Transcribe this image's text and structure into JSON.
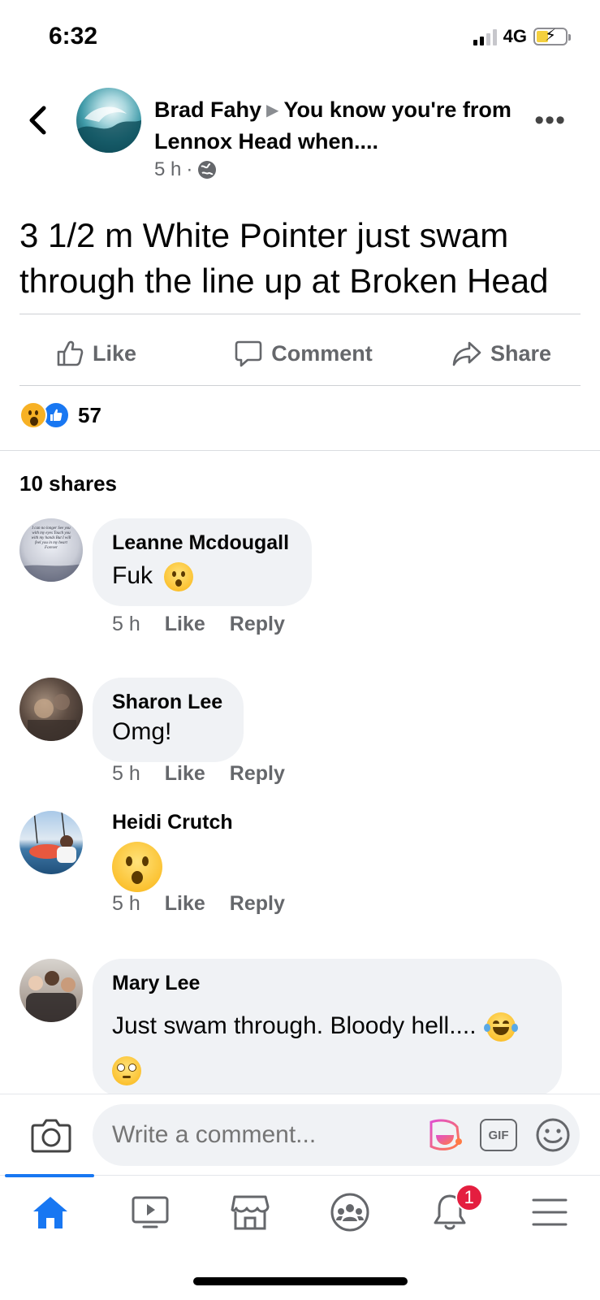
{
  "status_bar": {
    "time": "6:32",
    "network": "4G"
  },
  "header": {
    "author": "Brad Fahy",
    "group": "You know you're from Lennox Head when....",
    "time": "5 h"
  },
  "post": {
    "text": "3 1/2 m White Pointer just swam through the line up at Broken Head",
    "actions": {
      "like": "Like",
      "comment": "Comment",
      "share": "Share"
    },
    "reaction_count": "57",
    "shares_label": "10 shares"
  },
  "comments": [
    {
      "name": "Leanne Mcdougall",
      "text": "Fuk",
      "time": "5 h",
      "like": "Like",
      "reply": "Reply",
      "avatar_text": "I can no longer See you with my eyes Touch you with my hands But I will feel you in my heart Forever"
    },
    {
      "name": "Sharon Lee",
      "text": "Omg!",
      "time": "5 h",
      "like": "Like",
      "reply": "Reply"
    },
    {
      "name": "Heidi Crutch",
      "text": "",
      "time": "5 h",
      "like": "Like",
      "reply": "Reply"
    },
    {
      "name": "Mary Lee",
      "text": "Just swam through. Bloody hell....",
      "time": "",
      "like": "",
      "reply": ""
    }
  ],
  "composer": {
    "placeholder": "Write a comment...",
    "gif_label": "GIF"
  },
  "tab_bar": {
    "notification_count": "1"
  },
  "colors": {
    "accent": "#1877f2",
    "badge": "#e41e3f",
    "bubble": "#f0f2f5",
    "secondary_text": "#65676b"
  }
}
